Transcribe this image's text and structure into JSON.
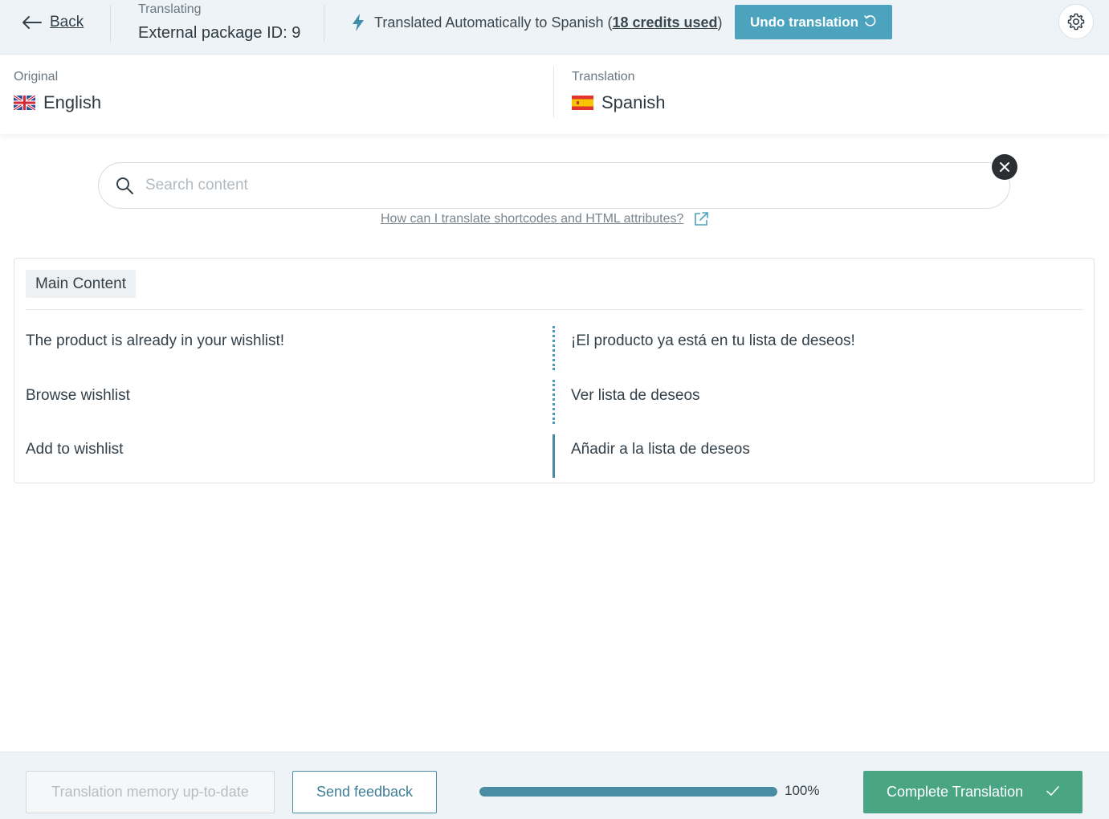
{
  "header": {
    "back_label": "Back",
    "package_label": "Translating",
    "package_name": "External package ID: 9",
    "auto_text": "Translated Automatically to Spanish (",
    "credits_text": "18 credits used",
    "auto_text_end": ")",
    "undo_label": "Undo translation",
    "icons": {
      "back": "arrow-left-icon",
      "auto": "lightning-icon",
      "undo": "undo-icon",
      "settings": "gear-icon"
    }
  },
  "languages": {
    "original": {
      "label": "Original",
      "name": "English",
      "flag": "uk-flag-icon"
    },
    "translation": {
      "label": "Translation",
      "name": "Spanish",
      "flag": "spain-flag-icon"
    }
  },
  "search": {
    "placeholder": "Search content",
    "help_link": "How can I translate shortcodes and HTML attributes?",
    "icons": {
      "search": "search-icon",
      "clear": "close-icon",
      "external": "external-link-icon"
    }
  },
  "content": {
    "section_label": "Main Content",
    "rows": [
      {
        "original": "The product is already in your wishlist!",
        "translation": "¡El producto ya está en tu lista de deseos!",
        "status": "automatic"
      },
      {
        "original": "Browse wishlist",
        "translation": "Ver lista de deseos",
        "status": "automatic"
      },
      {
        "original": "Add to wishlist",
        "translation": "Añadir a la lista de deseos",
        "status": "complete"
      }
    ]
  },
  "footer": {
    "memory_label": "Translation memory up-to-date",
    "feedback_label": "Send feedback",
    "progress": 100,
    "progress_label": "100%",
    "complete_label": "Complete Translation",
    "icons": {
      "complete": "check-icon"
    }
  },
  "colors": {
    "accent": "#4ba3bd",
    "success": "#4aa584",
    "progress": "#4a8ca4",
    "header_bg": "#eef3f7"
  }
}
